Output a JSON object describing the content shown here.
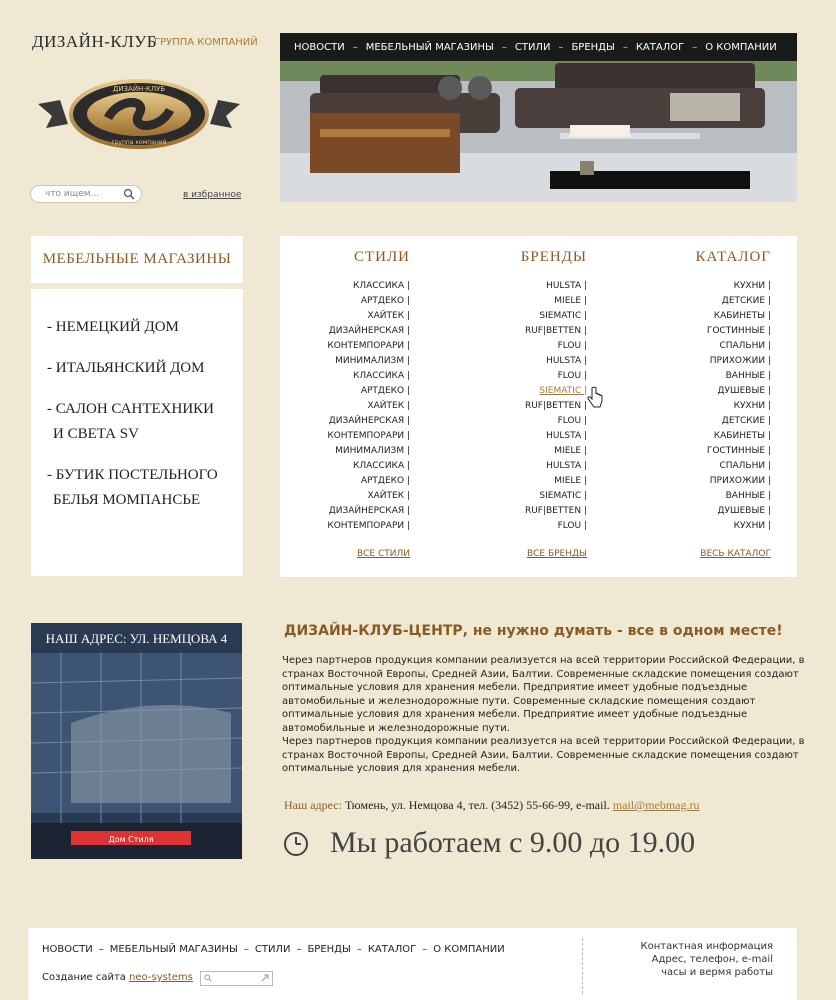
{
  "brand": {
    "title": "ДИЗАЙН-КЛУБ",
    "subtitle": "ГРУППА КОМПАНИЙ",
    "logo_top_text": "ДИЗАЙН-КЛУБ",
    "logo_bottom_text": "группа компаний"
  },
  "search": {
    "placeholder": "что ищем..."
  },
  "favorites_label": "в избранное",
  "topnav": {
    "items": [
      "НОВОСТИ",
      "МЕБЕЛЬНЫЙ МАГАЗИНЫ",
      "СТИЛИ",
      "БРЕНДЫ",
      "КАТАЛОГ",
      "О КОМПАНИИ"
    ],
    "separator": "–"
  },
  "stores": {
    "title": "МЕБЕЛЬНЫЕ МАГАЗИНЫ",
    "items": [
      {
        "line1": "- НЕМЕЦКИЙ ДОМ",
        "line2": ""
      },
      {
        "line1": "- ИТАЛЬЯНСКИЙ ДОМ",
        "line2": ""
      },
      {
        "line1": "- САЛОН САНТЕХНИКИ",
        "line2": "И СВЕТА SV"
      },
      {
        "line1": "- БУТИК ПОСТЕЛЬНОГО",
        "line2": "БЕЛЬЯ МОМПАНСЬЕ"
      }
    ]
  },
  "categories": {
    "styles": {
      "title": "СТИЛИ",
      "items": [
        "КЛАССИКА |",
        "АРТДЕКО |",
        "ХАЙТЕК |",
        "ДИЗАЙНЕРСКАЯ |",
        "КОНТЕМПОРАРИ |",
        "МИНИМАЛИЗМ |",
        "КЛАССИКА |",
        "АРТДЕКО |",
        "ХАЙТЕК |",
        "ДИЗАЙНЕРСКАЯ |",
        "КОНТЕМПОРАРИ |",
        "МИНИМАЛИЗМ |",
        "КЛАССИКА |",
        "АРТДЕКО |",
        "ХАЙТЕК |",
        "ДИЗАЙНЕРСКАЯ |",
        "КОНТЕМПОРАРИ |"
      ],
      "all_label": "ВСЕ СТИЛИ"
    },
    "brands": {
      "title": "БРЕНДЫ",
      "items": [
        "HULSTA |",
        "MIELE |",
        "SIEMATIC |",
        "RUF|BETTEN |",
        "FLOU |",
        "HULSTA |",
        "FLOU |",
        "SIEMATIC |",
        "RUF|BETTEN |",
        "FLOU |",
        "HULSTA |",
        "MIELE |",
        "HULSTA |",
        "MIELE |",
        "SIEMATIC |",
        "RUF|BETTEN |",
        "FLOU |"
      ],
      "highlighted_index": 7,
      "all_label": "ВСЕ БРЕНДЫ"
    },
    "catalog": {
      "title": "КАТАЛОГ",
      "items": [
        "КУХНИ |",
        "ДЕТСКИЕ |",
        "КАБИНЕТЫ |",
        "ГОСТИННЫЕ |",
        "СПАЛЬНИ |",
        "ПРИХОЖИИ |",
        "ВАННЫЕ |",
        "ДУШЕВЫЕ |",
        "КУХНИ |",
        "ДЕТСКИЕ |",
        "КАБИНЕТЫ |",
        "ГОСТИННЫЕ |",
        "СПАЛЬНИ |",
        "ПРИХОЖИИ |",
        "ВАННЫЕ |",
        "ДУШЕВЫЕ |",
        "КУХНИ |"
      ],
      "all_label": "ВЕСЬ КАТАЛОГ"
    }
  },
  "address_photo": {
    "caption": "НАШ АДРЕС: УЛ. НЕМЦОВА 4",
    "sign_text": "Дом Стиля"
  },
  "main": {
    "heading": "ДИЗАЙН-КЛУБ-ЦЕНТР, не нужно думать - все в одном месте!",
    "paragraphs": [
      "Через партнеров продукция компании реализуется на всей территории Российской Федерации, в странах Восточной Европы, Средней Азии, Балтии. Современные складские помещения создают оптимальные условия для хранения мебели. Предприятие имеет удобные подъездные автомобильные и железнодорожные пути. Современные складские помещения создают оптимальные условия для хранения мебели. Предприятие имеет удобные подъездные автомобильные и железнодорожные пути.",
      "Через партнеров продукция компании реализуется на всей территории Российской Федерации, в странах Восточной Европы, Средней Азии, Балтии. Современные складские помещения создают оптимальные условия для хранения мебели."
    ],
    "address_label": "Наш адрес:",
    "address_text": "Тюмень, ул. Немцова 4, тел. (3452) 55-66-99, e-mail.",
    "email": "mail@mebmag.ru",
    "hours": "Мы работаем с 9.00 до 19.00"
  },
  "footer": {
    "nav": [
      "НОВОСТИ",
      "МЕБЕЛЬНЫЙ МАГАЗИНЫ",
      "СТИЛИ",
      "БРЕНДЫ",
      "КАТАЛОГ",
      "О КОМПАНИИ"
    ],
    "separator": "–",
    "credit_prefix": "Создание сайта",
    "credit_link": "neo-systems",
    "contact_lines": [
      "Контактная информация",
      "Адрес, телефон, e-mail",
      "часы и вермя работы"
    ]
  },
  "colors": {
    "background": "#efe9d3",
    "accent": "#8a5a23",
    "link": "#a67b3a",
    "nav_bg": "#0d0d0d"
  }
}
